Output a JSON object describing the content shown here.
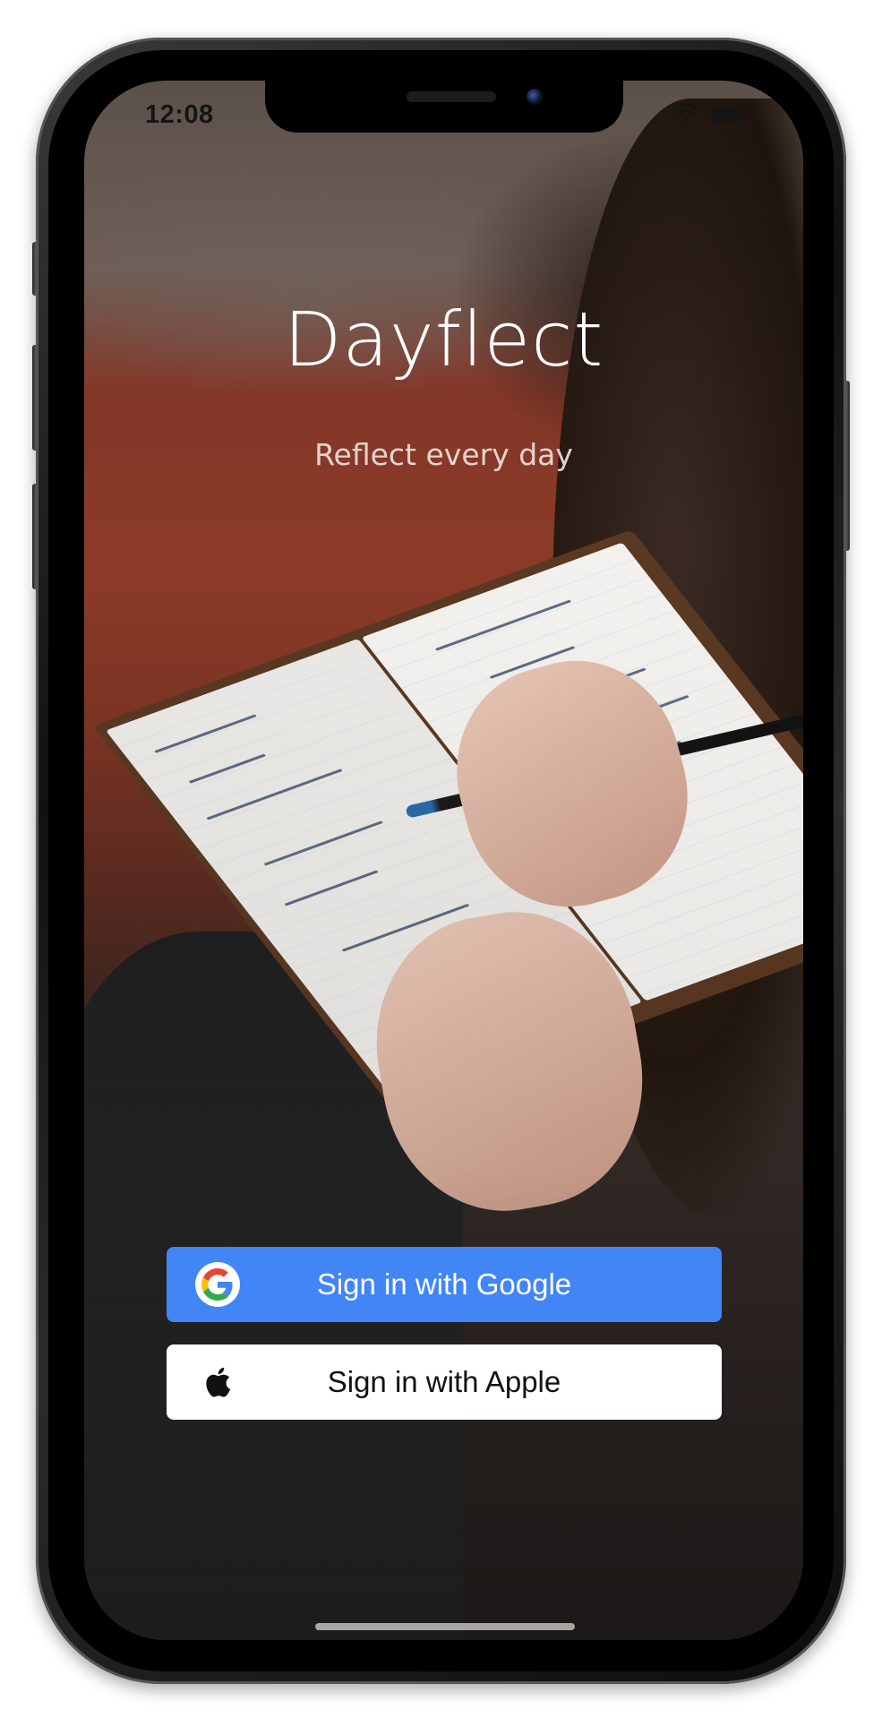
{
  "status_bar": {
    "time": "12:08"
  },
  "app": {
    "title": "Dayflect",
    "tagline": "Reflect every day"
  },
  "buttons": {
    "google_label": "Sign in with Google",
    "apple_label": "Sign in with Apple"
  },
  "colors": {
    "google_button": "#4285f4",
    "apple_button": "#ffffff",
    "title_text": "#ffffff"
  },
  "icons": {
    "google": "google-logo-icon",
    "apple": "apple-logo-icon",
    "wifi": "wifi-icon",
    "battery": "battery-icon"
  }
}
